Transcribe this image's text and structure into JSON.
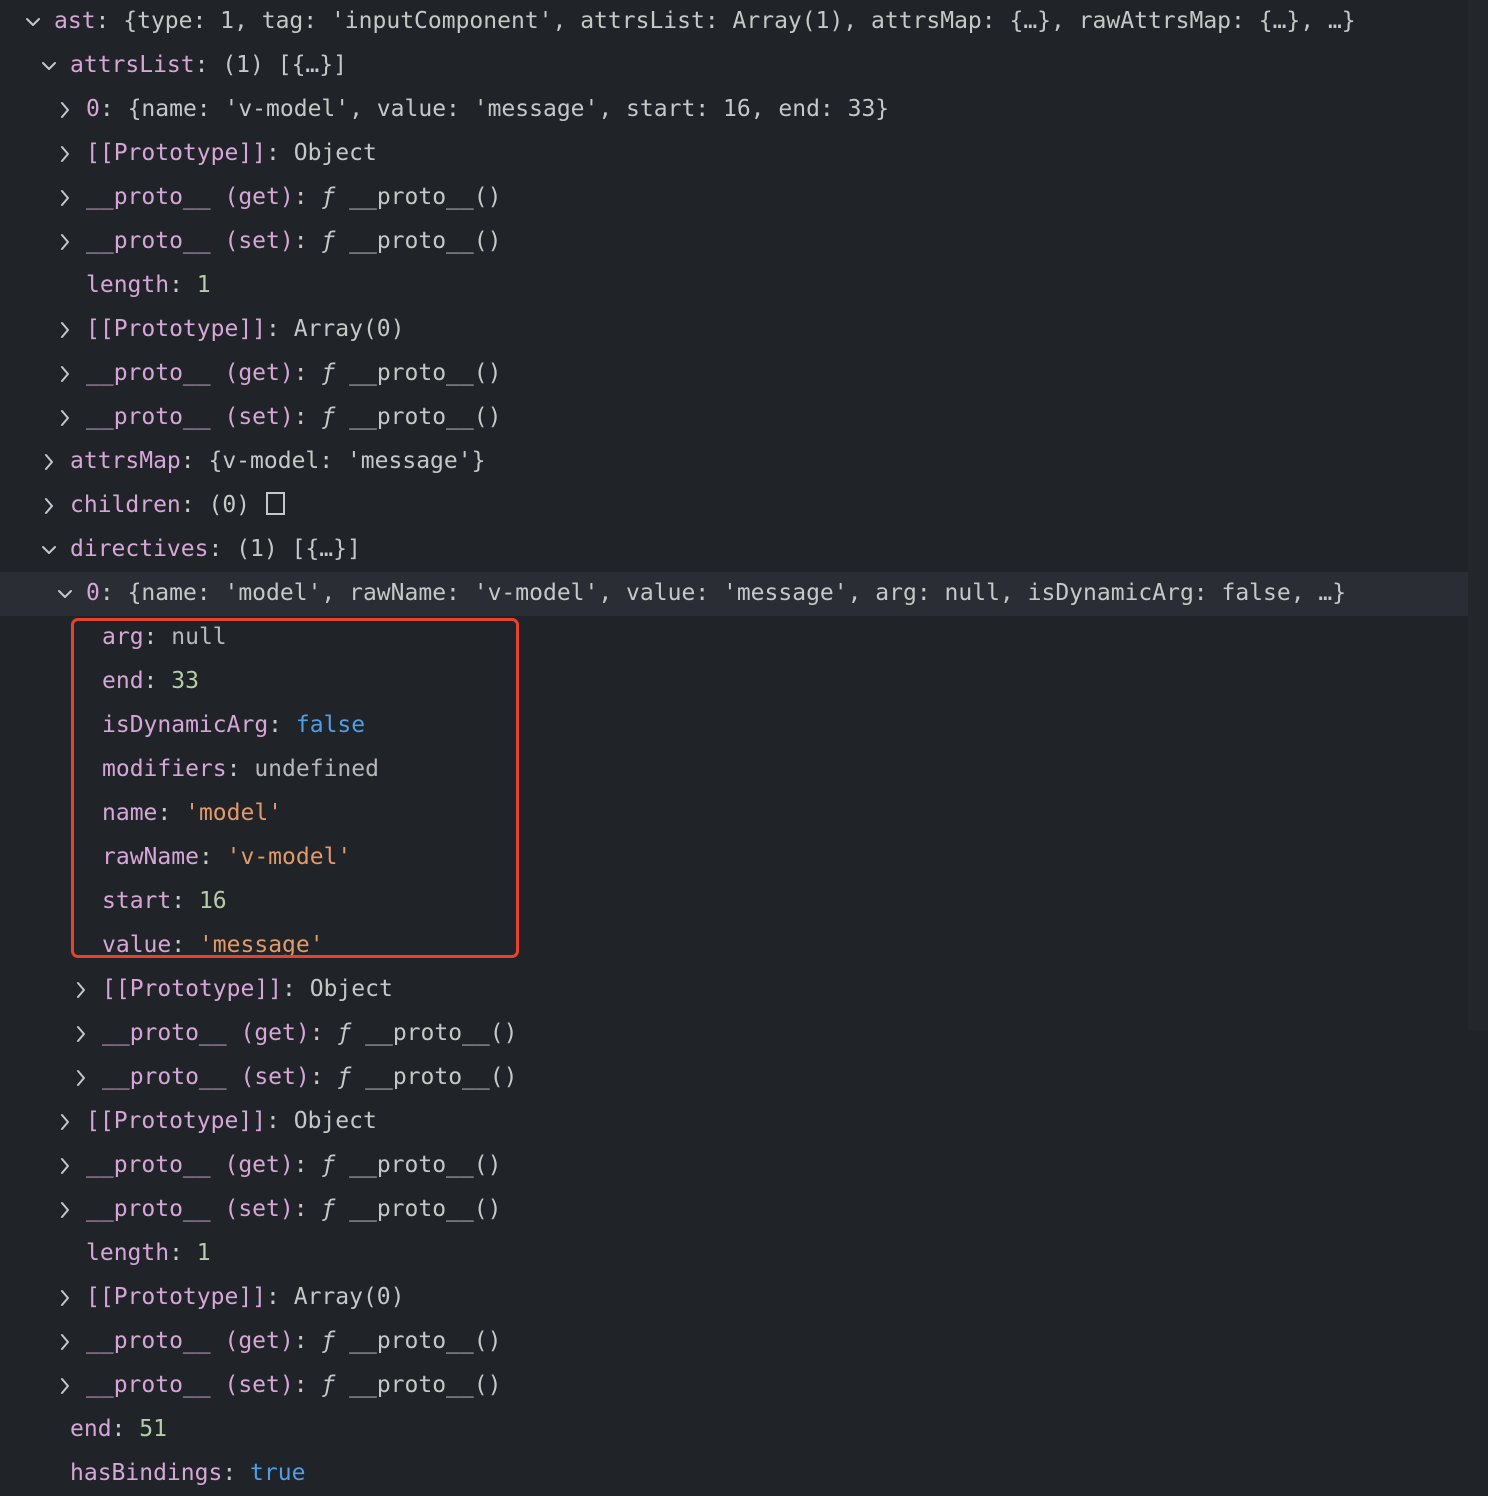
{
  "tree": [
    {
      "key": "ast",
      "summary": "{type: 1, tag: 'inputComponent', attrsList: Array(1), attrsMap: {…}, rawAttrsMap: {…}, …}",
      "depth": 0,
      "twisty": "expanded",
      "kind": "summary"
    },
    {
      "key": "attrsList",
      "summary": "(1) [{…}]",
      "depth": 1,
      "twisty": "expanded",
      "kind": "summary"
    },
    {
      "key": "0",
      "summary": "{name: 'v-model', value: 'message', start: 16, end: 33}",
      "depth": 2,
      "twisty": "collapsed",
      "kind": "summary"
    },
    {
      "key": "[[Prototype]]",
      "value": "Object",
      "depth": 2,
      "twisty": "collapsed",
      "kind": "text"
    },
    {
      "key": "__proto__ (get)",
      "value": "__proto__()",
      "depth": 2,
      "twisty": "collapsed",
      "kind": "fn"
    },
    {
      "key": "__proto__ (set)",
      "value": "__proto__()",
      "depth": 2,
      "twisty": "collapsed",
      "kind": "fn"
    },
    {
      "key": "length",
      "value": "1",
      "depth": 2,
      "twisty": "none",
      "kind": "num"
    },
    {
      "key": "[[Prototype]]",
      "value": "Array(0)",
      "depth": 2,
      "twisty": "collapsed",
      "kind": "text"
    },
    {
      "key": "__proto__ (get)",
      "value": "__proto__()",
      "depth": 2,
      "twisty": "collapsed",
      "kind": "fn"
    },
    {
      "key": "__proto__ (set)",
      "value": "__proto__()",
      "depth": 2,
      "twisty": "collapsed",
      "kind": "fn"
    },
    {
      "key": "attrsMap",
      "summary": "{v-model: 'message'}",
      "depth": 1,
      "twisty": "collapsed",
      "kind": "summary"
    },
    {
      "key": "children",
      "summary": "(0)",
      "depth": 1,
      "twisty": "collapsed",
      "kind": "empty-array"
    },
    {
      "key": "directives",
      "summary": "(1) [{…}]",
      "depth": 1,
      "twisty": "expanded",
      "kind": "summary"
    },
    {
      "key": "0",
      "summary": "{name: 'model', rawName: 'v-model', value: 'message', arg: null, isDynamicArg: false, …}",
      "depth": 2,
      "twisty": "expanded",
      "kind": "summary",
      "selected": true
    },
    {
      "key": "arg",
      "value": "null",
      "depth": 3,
      "twisty": "none",
      "kind": "null"
    },
    {
      "key": "end",
      "value": "33",
      "depth": 3,
      "twisty": "none",
      "kind": "num"
    },
    {
      "key": "isDynamicArg",
      "value": "false",
      "depth": 3,
      "twisty": "none",
      "kind": "bool"
    },
    {
      "key": "modifiers",
      "value": "undefined",
      "depth": 3,
      "twisty": "none",
      "kind": "null"
    },
    {
      "key": "name",
      "value": "'model'",
      "depth": 3,
      "twisty": "none",
      "kind": "str"
    },
    {
      "key": "rawName",
      "value": "'v-model'",
      "depth": 3,
      "twisty": "none",
      "kind": "str"
    },
    {
      "key": "start",
      "value": "16",
      "depth": 3,
      "twisty": "none",
      "kind": "num"
    },
    {
      "key": "value",
      "value": "'message'",
      "depth": 3,
      "twisty": "none",
      "kind": "str"
    },
    {
      "key": "[[Prototype]]",
      "value": "Object",
      "depth": 3,
      "twisty": "collapsed",
      "kind": "text"
    },
    {
      "key": "__proto__ (get)",
      "value": "__proto__()",
      "depth": 3,
      "twisty": "collapsed",
      "kind": "fn"
    },
    {
      "key": "__proto__ (set)",
      "value": "__proto__()",
      "depth": 3,
      "twisty": "collapsed",
      "kind": "fn"
    },
    {
      "key": "[[Prototype]]",
      "value": "Object",
      "depth": 2,
      "twisty": "collapsed",
      "kind": "text"
    },
    {
      "key": "__proto__ (get)",
      "value": "__proto__()",
      "depth": 2,
      "twisty": "collapsed",
      "kind": "fn"
    },
    {
      "key": "__proto__ (set)",
      "value": "__proto__()",
      "depth": 2,
      "twisty": "collapsed",
      "kind": "fn"
    },
    {
      "key": "length",
      "value": "1",
      "depth": 2,
      "twisty": "none",
      "kind": "num"
    },
    {
      "key": "[[Prototype]]",
      "value": "Array(0)",
      "depth": 2,
      "twisty": "collapsed",
      "kind": "text"
    },
    {
      "key": "__proto__ (get)",
      "value": "__proto__()",
      "depth": 2,
      "twisty": "collapsed",
      "kind": "fn"
    },
    {
      "key": "__proto__ (set)",
      "value": "__proto__()",
      "depth": 2,
      "twisty": "collapsed",
      "kind": "fn"
    },
    {
      "key": "end",
      "value": "51",
      "depth": 1,
      "twisty": "none",
      "kind": "num"
    },
    {
      "key": "hasBindings",
      "value": "true",
      "depth": 1,
      "twisty": "none",
      "kind": "bool"
    }
  ],
  "fn_prefix": "ƒ",
  "highlight": {
    "color": "#e6422d"
  }
}
